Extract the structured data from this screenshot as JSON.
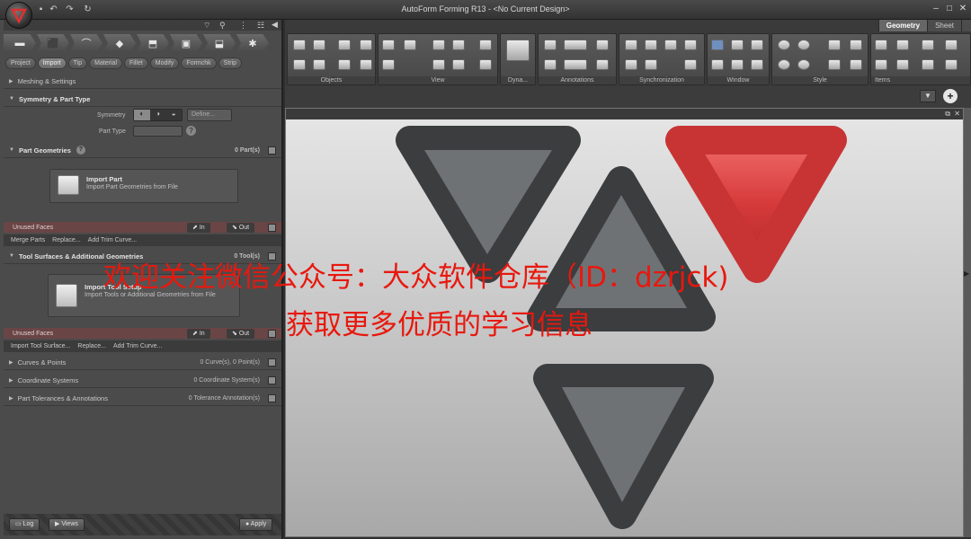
{
  "window": {
    "title": "AutoForm Forming R13 - <No Current Design>"
  },
  "left_panel": {
    "tabs": [
      "Project",
      "Import",
      "Tip",
      "Material",
      "Fillet",
      "Modify",
      "Formchk",
      "Strip"
    ],
    "meshing": "Meshing & Settings",
    "symmetry_section": "Symmetry & Part Type",
    "symmetry_label": "Symmetry",
    "define_label": "Define...",
    "part_type_label": "Part Type",
    "part_geometries": {
      "title": "Part Geometries",
      "count": "0 Part(s)"
    },
    "import_part": {
      "title": "Import Part",
      "desc": "Import Part Geometries from File"
    },
    "unused_faces": "Unused Faces",
    "in_label": "In",
    "out_label": "Out",
    "part_subbar": [
      "Merge Parts",
      "Replace...",
      "Add Trim Curve..."
    ],
    "tool_surfaces": {
      "title": "Tool Surfaces & Additional Geometries",
      "count": "0 Tool(s)"
    },
    "import_tool": {
      "title": "Import Tool Setup",
      "desc": "Import Tools or Additional Geometries from File"
    },
    "tool_subbar": [
      "Import Tool Surface...",
      "Replace...",
      "Add Trim Curve..."
    ],
    "curves": {
      "title": "Curves & Points",
      "count": "0 Curve(s), 0 Point(s)"
    },
    "coord": {
      "title": "Coordinate Systems",
      "count": "0 Coordinate System(s)"
    },
    "tolerances": {
      "title": "Part Tolerances & Annotations",
      "count": "0 Tolerance Annotation(s)"
    },
    "bottom": {
      "log": "Log",
      "views": "Views",
      "apply": "Apply"
    }
  },
  "ribbon": {
    "tabs": [
      "Geometry",
      "Sheet"
    ],
    "groups": [
      "Objects",
      "View",
      "Dyna...",
      "Annotations",
      "Synchronization",
      "Window",
      "Style",
      "Items"
    ]
  },
  "watermark": {
    "line1": "欢迎关注微信公众号：大众软件仓库（ID：dzrjck)",
    "line2": "获取更多优质的学习信息"
  },
  "colors": {
    "accent_red": "#e8180e",
    "triangle_red": "#d63a3a",
    "triangle_gray": "#6f7275"
  }
}
